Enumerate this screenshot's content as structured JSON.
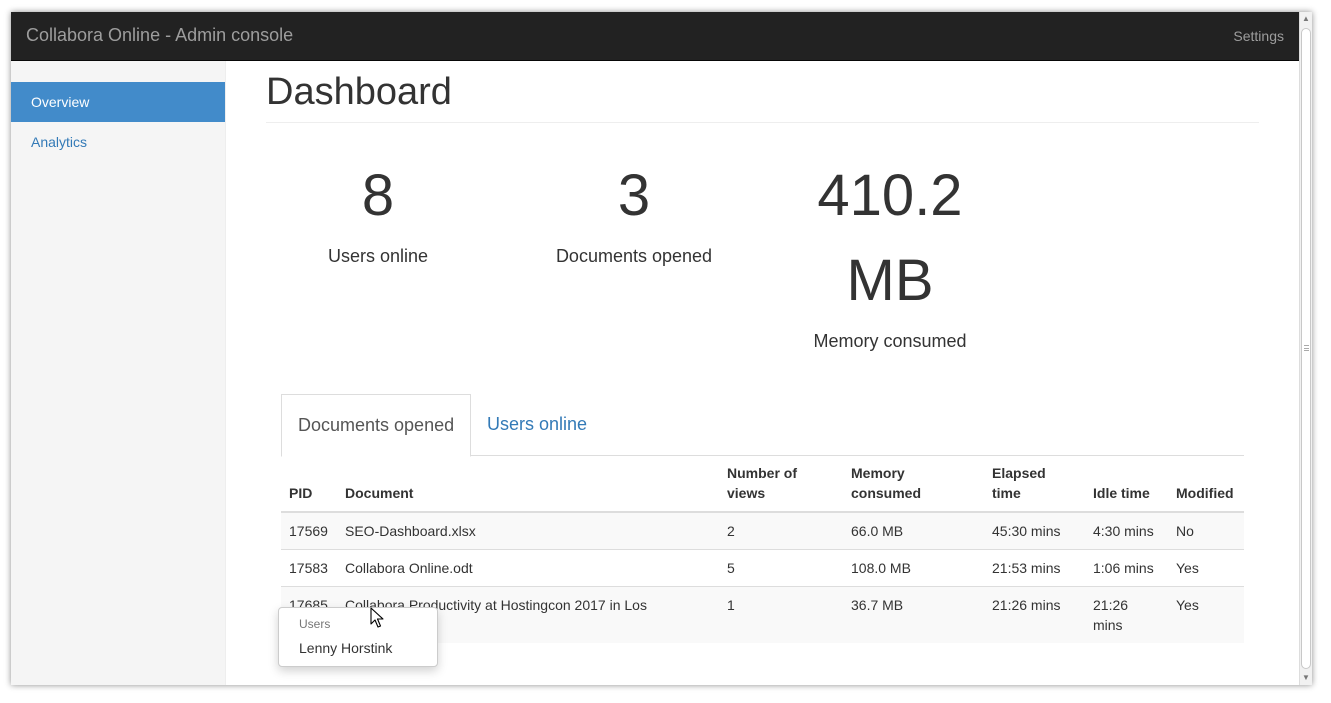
{
  "navbar": {
    "brand": "Collabora Online - Admin console",
    "settings_label": "Settings"
  },
  "sidebar": {
    "items": [
      {
        "label": "Overview",
        "active": true
      },
      {
        "label": "Analytics",
        "active": false
      }
    ]
  },
  "main": {
    "title": "Dashboard",
    "stats": [
      {
        "value": "8",
        "label": "Users online"
      },
      {
        "value": "3",
        "label": "Documents opened"
      },
      {
        "value_line1": "410.2",
        "value_line2": "MB",
        "label": "Memory consumed"
      }
    ],
    "tabs": [
      {
        "label": "Documents opened",
        "active": true
      },
      {
        "label": "Users online",
        "active": false
      }
    ],
    "table": {
      "headers": {
        "pid": "PID",
        "document": "Document",
        "views": "Number of views",
        "memory": "Memory consumed",
        "elapsed": "Elapsed time",
        "idle": "Idle time",
        "modified": "Modified"
      },
      "rows": [
        {
          "pid": "17569",
          "document": "SEO-Dashboard.xlsx",
          "views": "2",
          "memory": "66.0 MB",
          "elapsed": "45:30 mins",
          "idle": "4:30 mins",
          "modified": "No"
        },
        {
          "pid": "17583",
          "document": "Collabora Online.odt",
          "views": "5",
          "memory": "108.0 MB",
          "elapsed": "21:53 mins",
          "idle": "1:06 mins",
          "modified": "Yes"
        },
        {
          "pid": "17685",
          "document": "Collabora Productivity at Hostingcon 2017 in Los",
          "views": "1",
          "memory": "36.7 MB",
          "elapsed": "21:26 mins",
          "idle": "21:26 mins",
          "modified": "Yes"
        }
      ]
    },
    "users_popup": {
      "header": "Users",
      "user": "Lenny Horstink"
    }
  },
  "colors": {
    "navbar_bg": "#222222",
    "navbar_text": "#9d9d9d",
    "active_blue": "#428bca",
    "link_blue": "#337ab7"
  },
  "icons": {
    "cursor": "mouse-pointer-icon",
    "scroll_up": "scroll-up-arrow-icon",
    "scroll_down": "scroll-down-arrow-icon"
  }
}
